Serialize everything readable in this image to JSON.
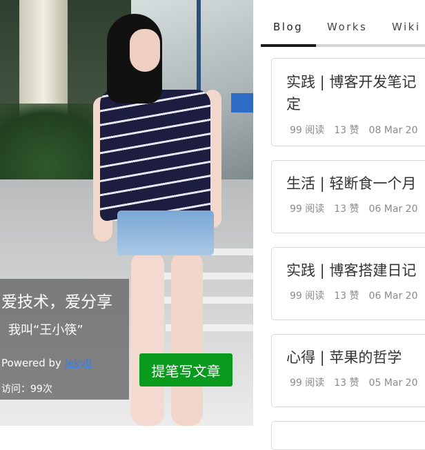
{
  "sidebar": {
    "motto": "爱技术，爱分享",
    "intro": "我叫“王小筷”",
    "powered_prefix": "Powered by ",
    "powered_link": "Jekyll",
    "visits": "访问：99次",
    "write_button": "提笔写文章"
  },
  "tabs": [
    {
      "label": "Blog"
    },
    {
      "label": "Works"
    },
    {
      "label": "Wiki"
    }
  ],
  "posts": [
    {
      "title_line1": "实践 | 博客开发笔记",
      "title_line2": "定",
      "reads": "99 阅读",
      "likes": "13 赞",
      "date": "08 Mar 20"
    },
    {
      "title_line1": "生活 | 轻断食一个月",
      "title_line2": "",
      "reads": "99 阅读",
      "likes": "13 赞",
      "date": "06 Mar 20"
    },
    {
      "title_line1": "实践 | 博客搭建日记",
      "title_line2": "",
      "reads": "99 阅读",
      "likes": "13 赞",
      "date": "06 Mar 20"
    },
    {
      "title_line1": "心得 | 苹果的哲学",
      "title_line2": "",
      "reads": "99 阅读",
      "likes": "13 赞",
      "date": "05 Mar 20"
    }
  ],
  "colors": {
    "button_green": "#0a9b1e",
    "link_blue": "#3b7fe0",
    "tab_active_underline": "#1a1a1a"
  }
}
